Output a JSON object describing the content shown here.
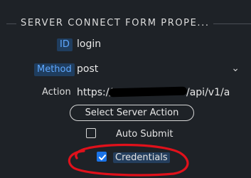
{
  "section": {
    "title": "SERVER CONNECT FORM PROPE..."
  },
  "fields": {
    "id": {
      "label": "ID",
      "value": "login"
    },
    "method": {
      "label": "Method",
      "value": "post"
    },
    "action": {
      "label": "Action",
      "value_head": "https://",
      "value_tail": "/api/v1/a"
    }
  },
  "buttons": {
    "select_server_action": "Select Server Action"
  },
  "checkboxes": {
    "auto_submit": {
      "label": "Auto Submit",
      "checked": false
    },
    "credentials": {
      "label": "Credentials",
      "checked": true
    }
  },
  "colors": {
    "background": "#1e2227",
    "accent": "#1a73e8",
    "tag_text": "#5fa8ff",
    "annotation": "#e0111b"
  }
}
